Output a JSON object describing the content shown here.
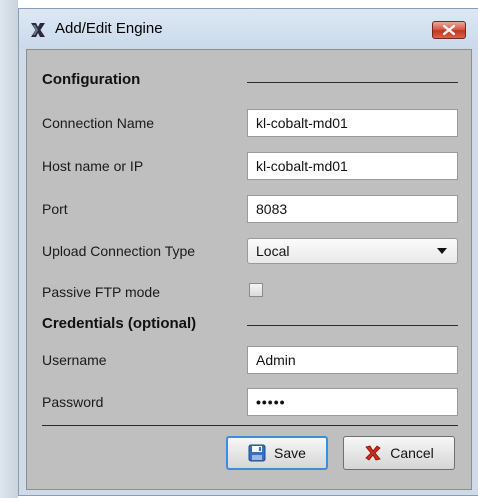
{
  "window": {
    "title": "Add/Edit Engine"
  },
  "sections": {
    "configuration": "Configuration",
    "credentials": "Credentials (optional)"
  },
  "fields": {
    "connection_name": {
      "label": "Connection Name",
      "value": "kl-cobalt-md01"
    },
    "host": {
      "label": "Host name or IP",
      "value": "kl-cobalt-md01"
    },
    "port": {
      "label": "Port",
      "value": "8083"
    },
    "upload_type": {
      "label": "Upload Connection Type",
      "value": "Local"
    },
    "passive_ftp": {
      "label": "Passive FTP mode",
      "checked": false
    },
    "username": {
      "label": "Username",
      "value": "Admin"
    },
    "password": {
      "label": "Password",
      "value": "•••••"
    }
  },
  "buttons": {
    "save": "Save",
    "cancel": "Cancel"
  },
  "colors": {
    "dialog_background": "#bfbfbf",
    "titlebar": "#cad9ea",
    "close_button": "#c2361f",
    "save_focus": "#3c8edc"
  },
  "icons": {
    "app": "app-x-icon",
    "close": "close-icon",
    "save": "floppy-disk-icon",
    "cancel": "red-x-icon",
    "dropdown": "dropdown-arrow-icon"
  }
}
